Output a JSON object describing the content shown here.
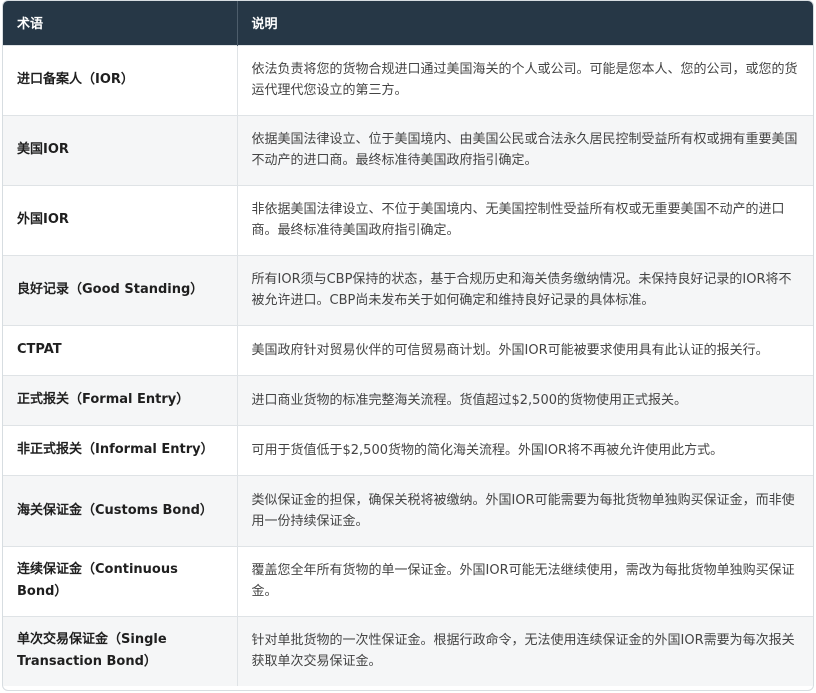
{
  "header": {
    "col_term": "术语",
    "col_desc": "说明"
  },
  "rows": [
    {
      "term": "进口备案人（IOR）",
      "desc": "依法负责将您的货物合规进口通过美国海关的个人或公司。可能是您本人、您的公司，或您的货运代理代您设立的第三方。"
    },
    {
      "term": "美国IOR",
      "desc": "依据美国法律设立、位于美国境内、由美国公民或合法永久居民控制受益所有权或拥有重要美国不动产的进口商。最终标准待美国政府指引确定。"
    },
    {
      "term": "外国IOR",
      "desc": "非依据美国法律设立、不位于美国境内、无美国控制性受益所有权或无重要美国不动产的进口商。最终标准待美国政府指引确定。"
    },
    {
      "term": "良好记录（Good Standing）",
      "desc": "所有IOR须与CBP保持的状态，基于合规历史和海关债务缴纳情况。未保持良好记录的IOR将不被允许进口。CBP尚未发布关于如何确定和维持良好记录的具体标准。"
    },
    {
      "term": "CTPAT",
      "desc": "美国政府针对贸易伙伴的可信贸易商计划。外国IOR可能被要求使用具有此认证的报关行。"
    },
    {
      "term": "正式报关（Formal Entry）",
      "desc": "进口商业货物的标准完整海关流程。货值超过$2,500的货物使用正式报关。"
    },
    {
      "term": "非正式报关（Informal Entry）",
      "desc": "可用于货值低于$2,500货物的简化海关流程。外国IOR将不再被允许使用此方式。"
    },
    {
      "term": "海关保证金（Customs Bond）",
      "desc": "类似保证金的担保，确保关税将被缴纳。外国IOR可能需要为每批货物单独购买保证金，而非使用一份持续保证金。"
    },
    {
      "term": "连续保证金（Continuous Bond）",
      "desc": "覆盖您全年所有货物的单一保证金。外国IOR可能无法继续使用，需改为每批货物单独购买保证金。"
    },
    {
      "term": "单次交易保证金（Single Transaction Bond）",
      "desc": "针对单批货物的一次性保证金。根据行政命令，无法使用连续保证金的外国IOR需要为每次报关获取单次交易保证金。"
    }
  ]
}
